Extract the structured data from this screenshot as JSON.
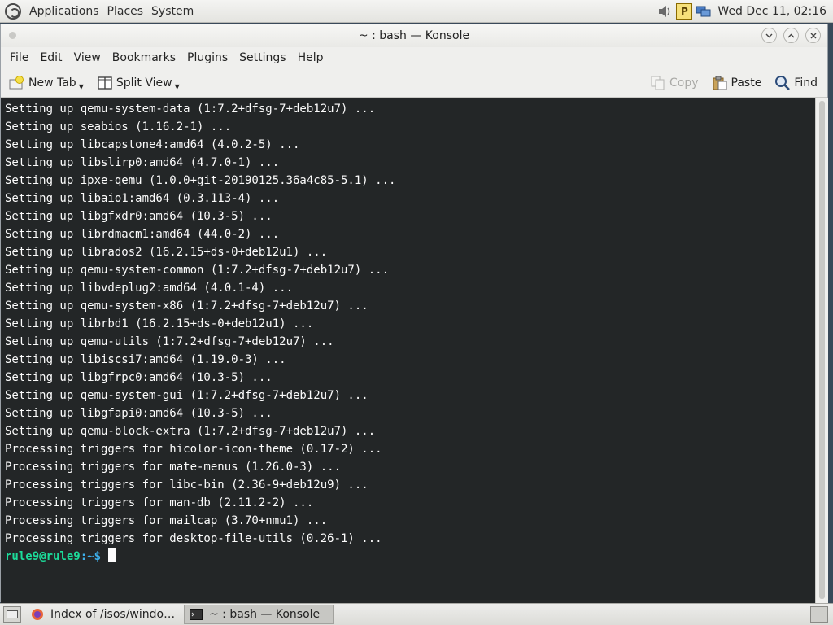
{
  "top_panel": {
    "menus": [
      "Applications",
      "Places",
      "System"
    ],
    "clock": "Wed Dec 11, 02:16",
    "tray": [
      {
        "icon": "speaker-icon"
      },
      {
        "icon": "p-indicator-icon",
        "text": "P"
      },
      {
        "icon": "network-icon"
      }
    ]
  },
  "window": {
    "title": "~ : bash — Konsole",
    "menus": [
      "File",
      "Edit",
      "View",
      "Bookmarks",
      "Plugins",
      "Settings",
      "Help"
    ],
    "toolbar": {
      "new_tab": "New Tab",
      "split_view": "Split View",
      "copy": "Copy",
      "paste": "Paste",
      "find": "Find"
    }
  },
  "terminal": {
    "lines": [
      "Setting up qemu-system-data (1:7.2+dfsg-7+deb12u7) ...",
      "Setting up seabios (1.16.2-1) ...",
      "Setting up libcapstone4:amd64 (4.0.2-5) ...",
      "Setting up libslirp0:amd64 (4.7.0-1) ...",
      "Setting up ipxe-qemu (1.0.0+git-20190125.36a4c85-5.1) ...",
      "Setting up libaio1:amd64 (0.3.113-4) ...",
      "Setting up libgfxdr0:amd64 (10.3-5) ...",
      "Setting up librdmacm1:amd64 (44.0-2) ...",
      "Setting up librados2 (16.2.15+ds-0+deb12u1) ...",
      "Setting up qemu-system-common (1:7.2+dfsg-7+deb12u7) ...",
      "Setting up libvdeplug2:amd64 (4.0.1-4) ...",
      "Setting up qemu-system-x86 (1:7.2+dfsg-7+deb12u7) ...",
      "Setting up librbd1 (16.2.15+ds-0+deb12u1) ...",
      "Setting up qemu-utils (1:7.2+dfsg-7+deb12u7) ...",
      "Setting up libiscsi7:amd64 (1.19.0-3) ...",
      "Setting up libgfrpc0:amd64 (10.3-5) ...",
      "Setting up qemu-system-gui (1:7.2+dfsg-7+deb12u7) ...",
      "Setting up libgfapi0:amd64 (10.3-5) ...",
      "Setting up qemu-block-extra (1:7.2+dfsg-7+deb12u7) ...",
      "Processing triggers for hicolor-icon-theme (0.17-2) ...",
      "Processing triggers for mate-menus (1.26.0-3) ...",
      "Processing triggers for libc-bin (2.36-9+deb12u9) ...",
      "Processing triggers for man-db (2.11.2-2) ...",
      "Processing triggers for mailcap (3.70+nmu1) ...",
      "Processing triggers for desktop-file-utils (0.26-1) ..."
    ],
    "prompt_user": "rule9@rule9",
    "prompt_path": ":~$"
  },
  "taskbar": {
    "tasks": [
      {
        "label": "Index of /isos/window...",
        "icon": "firefox-icon"
      },
      {
        "label": "~ : bash — Konsole",
        "icon": "terminal-icon",
        "active": true
      }
    ]
  },
  "colors": {
    "terminal_bg": "#232627",
    "terminal_fg": "#fcfcfc",
    "prompt_user": "#1cdc9a",
    "prompt_path": "#3daee9"
  }
}
